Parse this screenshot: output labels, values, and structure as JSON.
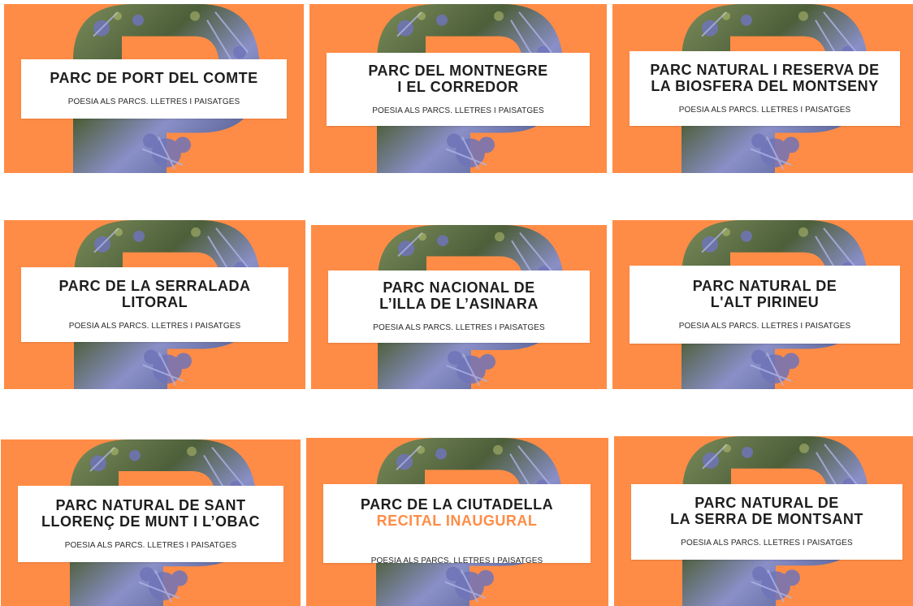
{
  "colors": {
    "card_bg": "#ff8c46",
    "accent_text": "#ff8c46",
    "title_text": "#1e1e1e",
    "panel_bg": "#ffffff",
    "flower_blue": "#6f74b8",
    "foliage_green": "#6f8a4e"
  },
  "cards": [
    {
      "title": "PARC DE PORT DEL COMTE",
      "accent": "",
      "subtitle": "POESIA ALS PARCS. LLETRES I PAISATGES"
    },
    {
      "title": "PARC DEL MONTNEGRE\nI EL CORREDOR",
      "accent": "",
      "subtitle": "POESIA ALS PARCS. LLETRES I PAISATGES"
    },
    {
      "title": "PARC NATURAL I RESERVA DE\nLA BIOSFERA DEL MONTSENY",
      "accent": "",
      "subtitle": "POESIA ALS PARCS. LLETRES I PAISATGES"
    },
    {
      "title": "PARC DE LA SERRALADA\nLITORAL",
      "accent": "",
      "subtitle": "POESIA ALS PARCS. LLETRES I PAISATGES"
    },
    {
      "title": "PARC NACIONAL DE\nL’ILLA DE L’ASINARA",
      "accent": "",
      "subtitle": "POESIA ALS PARCS. LLETRES I PAISATGES"
    },
    {
      "title": "PARC NATURAL DE\nL'ALT PIRINEU",
      "accent": "",
      "subtitle": "POESIA ALS PARCS. LLETRES I PAISATGES"
    },
    {
      "title": "PARC NATURAL DE SANT\nLLORENÇ DE MUNT I L’OBAC",
      "accent": "",
      "subtitle": "POESIA ALS PARCS. LLETRES I PAISATGES"
    },
    {
      "title": "PARC DE LA CIUTADELLA",
      "accent": "RECITAL INAUGURAL",
      "subtitle": "POESIA ALS PARCS. LLETRES I PAISATGES"
    },
    {
      "title": "PARC NATURAL DE\nLA SERRA DE MONTSANT",
      "accent": "",
      "subtitle": "POESIA ALS PARCS. LLETRES I PAISATGES"
    }
  ]
}
